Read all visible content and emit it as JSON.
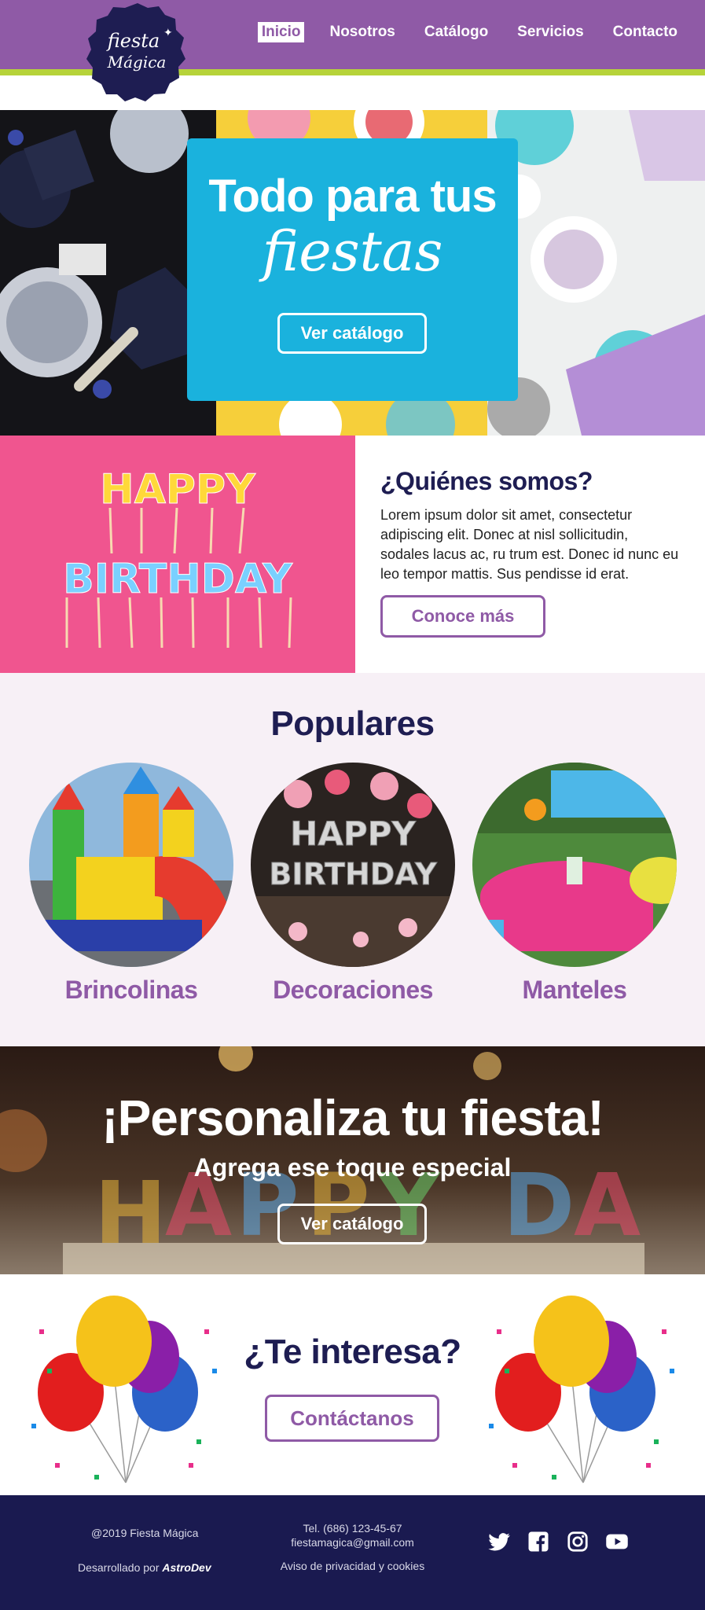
{
  "header": {
    "logo_text_line1": "fiesta",
    "logo_text_line2": "Mágica",
    "nav": [
      "Inicio",
      "Nosotros",
      "Catálogo",
      "Servicios",
      "Contacto"
    ]
  },
  "hero": {
    "title_line1": "Todo para tus",
    "title_line2": "fiestas",
    "button": "Ver catálogo"
  },
  "about": {
    "title": "¿Quiénes somos?",
    "body": "Lorem ipsum dolor sit amet, consectetur adipiscing elit. Donec at nisl sollicitudin, sodales lacus ac, ru trum est. Donec id nunc eu leo tempor mattis. Sus pendisse id erat.",
    "button": "Conoce más",
    "image_text_top": "HAPPY",
    "image_text_bottom": "BIRTHDAY"
  },
  "popular": {
    "title": "Populares",
    "items": [
      "Brincolinas",
      "Decoraciones",
      "Manteles"
    ]
  },
  "banner": {
    "title": "¡Personaliza tu fiesta!",
    "subtitle": "Agrega ese toque especial",
    "button": "Ver catálogo"
  },
  "cta": {
    "title": "¿Te interesa?",
    "button": "Contáctanos"
  },
  "footer": {
    "copyright": "@2019 Fiesta Mágica",
    "developed_by": "Desarrollado por",
    "developer": "AstroDev",
    "phone": "Tel. (686) 123-45-67",
    "email": "fiestamagica@gmail.com",
    "privacy": "Aviso de privacidad y cookies",
    "socials": [
      "twitter-icon",
      "facebook-icon",
      "instagram-icon",
      "youtube-icon"
    ]
  },
  "colors": {
    "purple": "#8f5aa6",
    "lime": "#b6d33a",
    "navy": "#1e1d52",
    "cyan": "#1ab2dd",
    "pink": "#f0558f",
    "footer": "#1a1a50"
  }
}
